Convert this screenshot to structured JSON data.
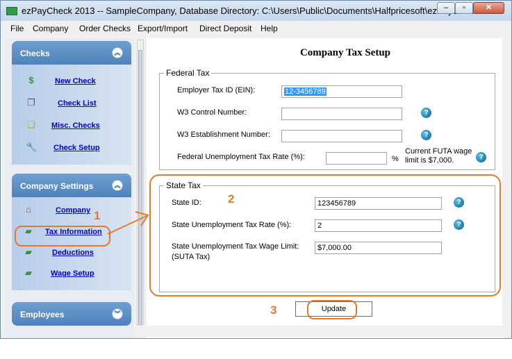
{
  "window": {
    "title": "ezPayCheck 2013 -- SampleCompany, Database Directory: C:\\Users\\Public\\Documents\\Halfpricesoft\\ezPayChe...",
    "min_glyph": "–",
    "max_glyph": "▫",
    "close_glyph": "✕"
  },
  "menu": {
    "file": "File",
    "company": "Company",
    "order_checks": "Order Checks",
    "export_import": "Export/Import",
    "direct_deposit": "Direct Deposit",
    "help": "Help"
  },
  "sidebar": {
    "checks_panel": {
      "title": "Checks",
      "items": [
        "New Check",
        "Check List",
        "Misc. Checks",
        "Check Setup"
      ]
    },
    "company_settings_panel": {
      "title": "Company Settings",
      "items": [
        "Company",
        "Tax Information",
        "Deductions",
        "Wage Setup"
      ]
    },
    "employees_panel": {
      "title": "Employees"
    },
    "collapse_up_glyph": "︽",
    "expand_down_glyph": "︾"
  },
  "main": {
    "title": "Company Tax Setup",
    "federal": {
      "legend": "Federal Tax",
      "ein_label": "Employer Tax ID (EIN):",
      "ein_value": "12-3456789",
      "w3_control_label": "W3 Control Number:",
      "w3_control_value": "",
      "w3_establishment_label": "W3 Establishment Number:",
      "w3_establishment_value": "",
      "futa_rate_label": "Federal Unemployment Tax Rate  (%):",
      "futa_rate_value": "",
      "percent_sign": "%",
      "futa_note_line1": "Current FUTA wage",
      "futa_note_line2": "limit is $7,000."
    },
    "state": {
      "legend": "State Tax",
      "state_id_label": "State ID:",
      "state_id_value": "123456789",
      "suta_rate_label": "State Unemployment Tax Rate  (%):",
      "suta_rate_value": "2",
      "suta_limit_label_line1": "State Unemployment Tax Wage Limit:",
      "suta_limit_label_line2": "(SUTA Tax)",
      "suta_limit_value": "$7,000.00"
    },
    "update_button": "Update",
    "help_glyph": "?"
  },
  "annotations": {
    "step1": "1",
    "step2": "2",
    "step3": "3",
    "accent_color": "#e8792c"
  },
  "colors": {
    "panel_header": "#5a8cc4",
    "link": "#0000cc",
    "selection": "#3399ff"
  },
  "icons": {
    "new_check": "dollar-icon",
    "check_list": "pages-icon",
    "misc_checks": "jar-icon",
    "check_setup": "wrench-icon",
    "company": "house-icon",
    "tax_information": "money-icon",
    "deductions": "money-minus-icon",
    "wage_setup": "money-gear-icon"
  }
}
